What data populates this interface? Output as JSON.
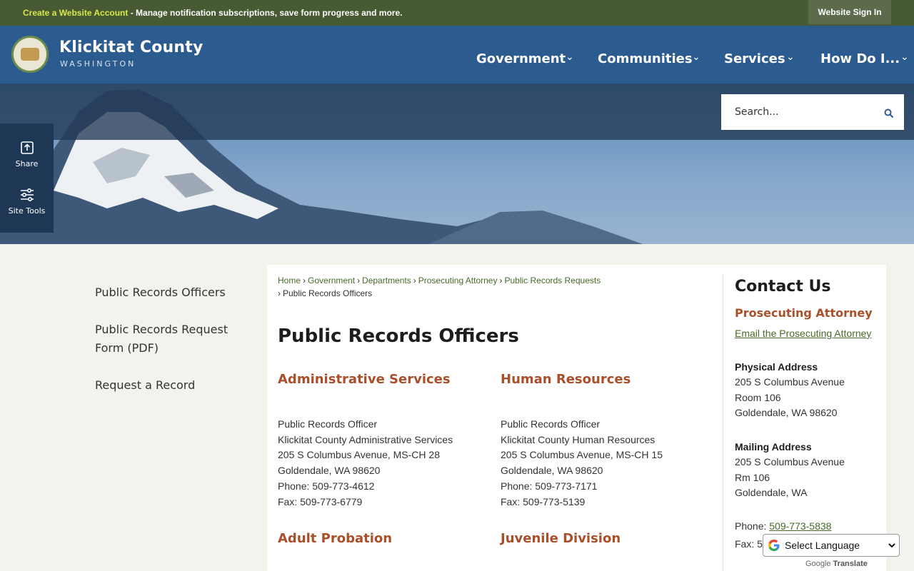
{
  "topbar": {
    "create_account": "Create a Website Account",
    "message": " - Manage notification subscriptions, save form progress and more.",
    "sign_in": "Website Sign In"
  },
  "brand": {
    "name": "Klickitat County",
    "sub": "WASHINGTON"
  },
  "nav": [
    "Government",
    "Communities",
    "Services",
    "How Do I..."
  ],
  "search": {
    "placeholder": "Search..."
  },
  "tools": {
    "share": "Share",
    "site_tools": "Site Tools"
  },
  "leftnav": [
    "Public Records Officers",
    "Public Records Request Form (PDF)",
    "Request a Record"
  ],
  "breadcrumb": [
    "Home",
    "Government",
    "Departments",
    "Prosecuting Attorney",
    "Public Records Requests",
    "Public Records Officers"
  ],
  "page_title": "Public Records Officers",
  "sections": [
    {
      "title": "Administrative Services",
      "lines": [
        "Public Records Officer",
        "Klickitat County Administrative Services",
        "205 S Columbus Avenue, MS-CH 28",
        "Goldendale, WA 98620",
        "Phone: 509-773-4612",
        "Fax: 509-773-6779"
      ]
    },
    {
      "title": "Human Resources",
      "lines": [
        "Public Records Officer",
        "Klickitat County Human Resources",
        "205 S Columbus Avenue, MS-CH 15",
        "Goldendale, WA 98620",
        "Phone: 509-773-7171",
        "Fax: 509-773-5139"
      ]
    },
    {
      "title": "Adult Probation",
      "lines": []
    },
    {
      "title": "Juvenile Division",
      "lines": []
    }
  ],
  "contact": {
    "heading": "Contact Us",
    "department": "Prosecuting Attorney",
    "email_link": "Email the Prosecuting Attorney",
    "physical_label": "Physical Address",
    "physical": [
      "205 S Columbus Avenue",
      "Room 106",
      "Goldendale, WA 98620"
    ],
    "mailing_label": "Mailing Address",
    "mailing": [
      "205 S Columbus Avenue",
      "Rm 106",
      "Goldendale, WA"
    ],
    "phone_label": "Phone: ",
    "phone": "509-773-5838",
    "fax_label": "Fax: 5"
  },
  "translate": {
    "select_label": "Select Language",
    "powered": "Google",
    "translate": "Translate"
  },
  "colors": {
    "topbar": "#475a33",
    "header": "#2b5b8f",
    "accent_heading": "#a9502a",
    "link": "#476a28",
    "page_bg": "#f4f2ec"
  },
  "icons": {
    "share": "share-icon",
    "site_tools": "sliders-icon",
    "search": "search-icon",
    "chevron": "chevron-down-icon",
    "google": "google-g-icon"
  }
}
